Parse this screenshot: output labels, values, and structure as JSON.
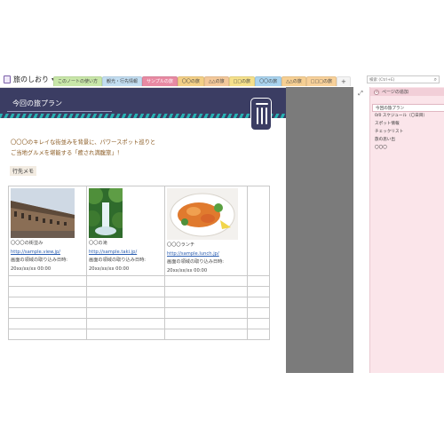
{
  "notebook": {
    "title": "旅のしおり",
    "icon": "notebook-icon",
    "menu_icon": "chevron-down-icon"
  },
  "tabs": [
    {
      "label": "このノートの使い方",
      "color": "#c8e6a8",
      "active": false
    },
    {
      "label": "観光・行先情報",
      "color": "#c2ddf1",
      "active": false
    },
    {
      "label": "サンプルの旅",
      "color": "#e88aa3",
      "active": true
    },
    {
      "label": "〇〇の旅",
      "color": "#f3cf86",
      "active": false
    },
    {
      "label": "△△の旅",
      "color": "#f3c89a",
      "active": false
    },
    {
      "label": "□□の旅",
      "color": "#f5e08a",
      "active": false
    },
    {
      "label": "〇〇の旅",
      "color": "#a9d3ee",
      "active": false
    },
    {
      "label": "△△の旅",
      "color": "#f6cf93",
      "active": false
    },
    {
      "label": "□□□の旅",
      "color": "#f8d19a",
      "active": false
    }
  ],
  "add_tab_label": "+",
  "search": {
    "placeholder": "検索 (Ctrl+E)",
    "icon": "magnifier-icon"
  },
  "page": {
    "title": "今回の旅プラン",
    "intro_line1": "〇〇〇のキレイな街並みを背景に、パワースポット巡りと",
    "intro_line2": "ご当地グルメを堪能する「癒され満腹旅」！",
    "memo_label": "行先メモ",
    "trash_icon": "trash-can-icon",
    "entries": [
      {
        "image": "street-photo",
        "name": "〇〇〇の街並み",
        "url": "http://sample.view.jp/",
        "clip": "画面の領域の取り込み日時:",
        "date": "20xx/xx/xx 00:00"
      },
      {
        "image": "waterfall-photo",
        "name": "〇〇の滝",
        "url": "http://sample.taki.jp/",
        "clip": "画面の領域の取り込み日時:",
        "date": "20xx/xx/xx 00:00"
      },
      {
        "image": "lunch-photo",
        "name": "〇〇〇ランチ",
        "url": "http://sample.lunch.jp/",
        "clip": "画面の領域の取り込み日時:",
        "date": "20xx/xx/xx 00:00"
      }
    ]
  },
  "panel": {
    "add_page_label": "ページの追加",
    "pages": [
      "今回の旅プラン",
      "0/0 スケジュール（〇日目）",
      "スポット情報",
      "チェックリスト",
      "旅の思い出",
      "〇〇〇"
    ]
  },
  "colors": {
    "banner": "#3b3d63",
    "accent_stripe": "#27b3b3",
    "intro_text": "#8a5a22",
    "panel_bg": "#fbe5ea",
    "margin_gray": "#7b7b7b"
  }
}
